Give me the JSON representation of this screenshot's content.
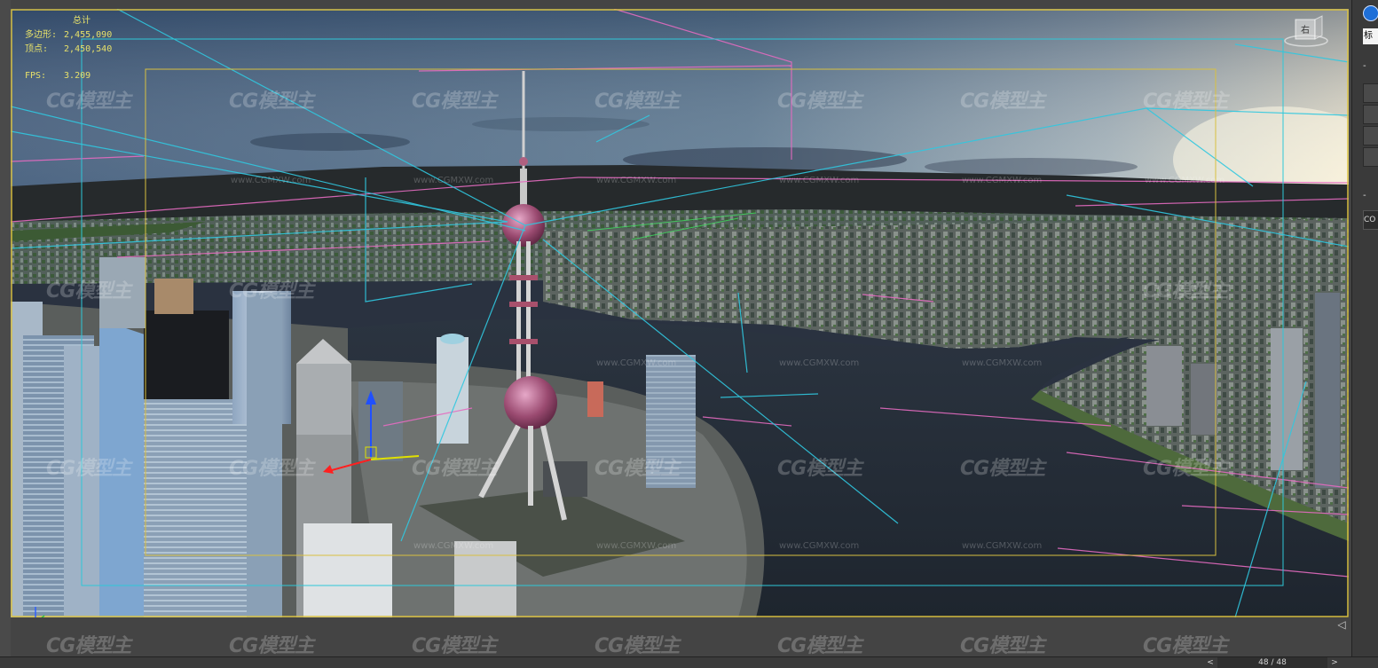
{
  "stats": {
    "title": "总计",
    "polygons_label": "多边形:",
    "polygons_value": "2,455,090",
    "vertices_label": "顶点:",
    "vertices_value": "2,450,540",
    "fps_label": "FPS:",
    "fps_value": "3.209"
  },
  "viewcube": {
    "label": "右"
  },
  "watermark": {
    "logo": "CG模型主",
    "url": "www.CGMXW.com"
  },
  "right_panel": {
    "label_text": "标",
    "field_text": "CO",
    "collapse_symbol": "-"
  },
  "bottom_bar": {
    "page_counter": "48 / 48",
    "prev_symbol": "<",
    "next_symbol": ">"
  },
  "icons": {
    "viewcube": "viewcube-icon",
    "axis": "axis-gizmo-icon",
    "toggle": "radio-toggle-icon",
    "maximize": "maximize-viewport-icon"
  },
  "colors": {
    "stats_text": "#e6e06a",
    "safe_frame_outer": "#d8c040",
    "safe_frame_inner": "#2ec8d8",
    "spline_pink": "#e46bc0",
    "spline_cyan": "#30c8e0"
  }
}
